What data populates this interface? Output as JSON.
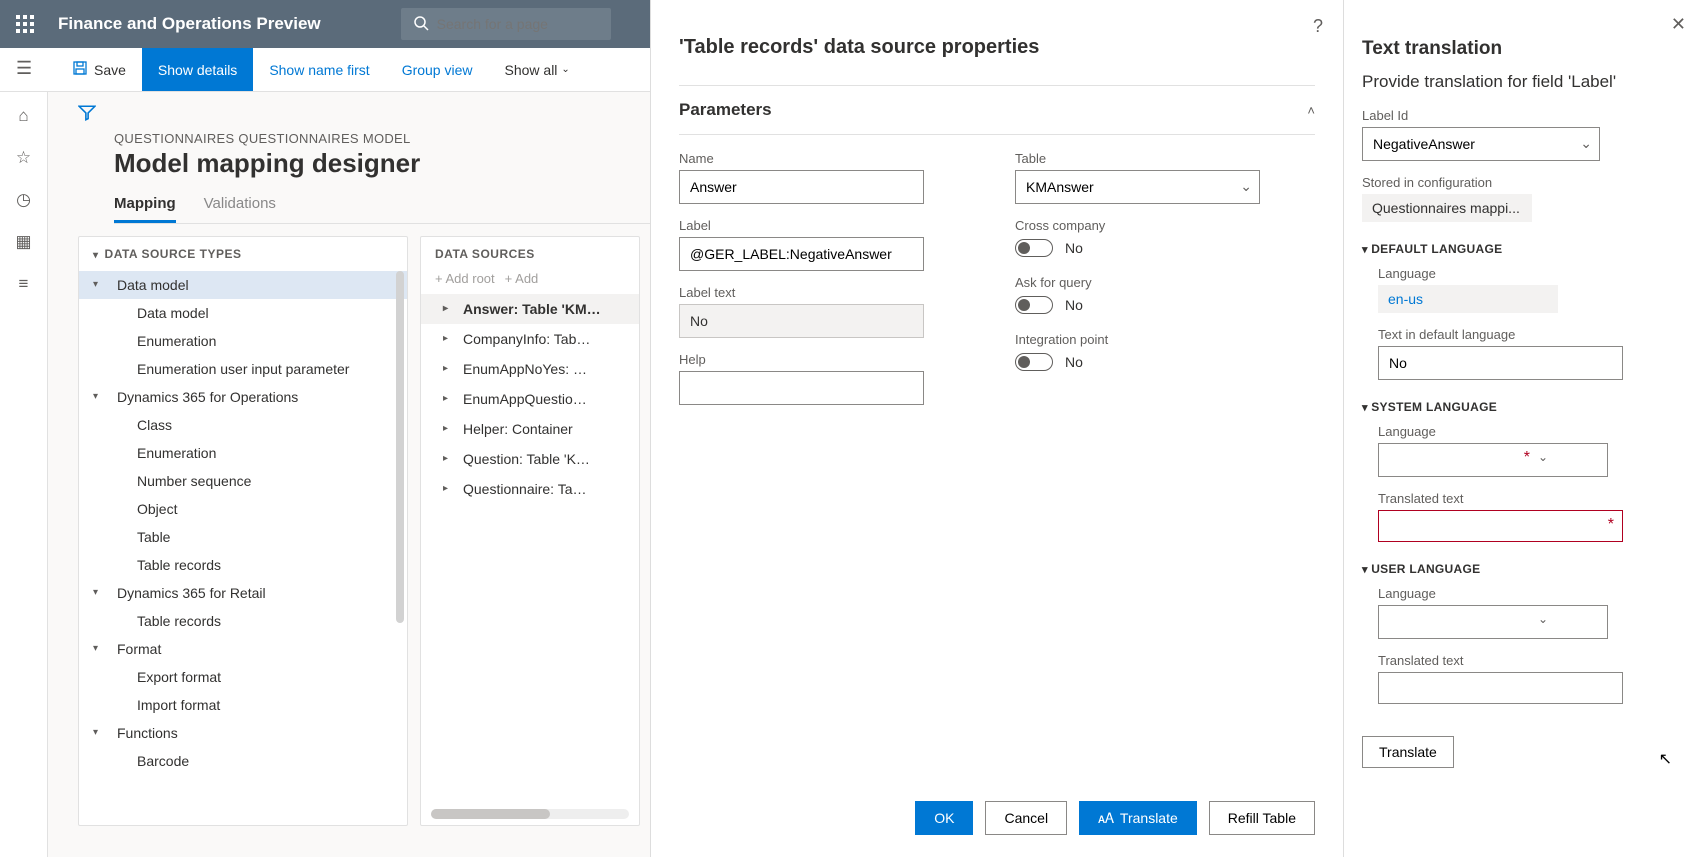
{
  "header": {
    "title": "Finance and Operations Preview",
    "search_placeholder": "Search for a page"
  },
  "actions": {
    "save": "Save",
    "show_details": "Show details",
    "show_name_first": "Show name first",
    "group_view": "Group view",
    "show_all": "Show all"
  },
  "page": {
    "breadcrumb": "QUESTIONNAIRES QUESTIONNAIRES MODEL",
    "title": "Model mapping designer",
    "tabs": [
      "Mapping",
      "Validations"
    ],
    "active_tab": 0
  },
  "ds_types": {
    "header": "DATA SOURCE TYPES",
    "items": [
      {
        "label": "Data model",
        "level": 0,
        "expanded": true,
        "selected": true
      },
      {
        "label": "Data model",
        "level": 1
      },
      {
        "label": "Enumeration",
        "level": 1
      },
      {
        "label": "Enumeration user input parameter",
        "level": 1
      },
      {
        "label": "Dynamics 365 for Operations",
        "level": 0,
        "expanded": true
      },
      {
        "label": "Class",
        "level": 1
      },
      {
        "label": "Enumeration",
        "level": 1
      },
      {
        "label": "Number sequence",
        "level": 1
      },
      {
        "label": "Object",
        "level": 1
      },
      {
        "label": "Table",
        "level": 1
      },
      {
        "label": "Table records",
        "level": 1
      },
      {
        "label": "Dynamics 365 for Retail",
        "level": 0,
        "expanded": true
      },
      {
        "label": "Table records",
        "level": 1
      },
      {
        "label": "Format",
        "level": 0,
        "expanded": true
      },
      {
        "label": "Export format",
        "level": 1
      },
      {
        "label": "Import format",
        "level": 1
      },
      {
        "label": "Functions",
        "level": 0,
        "expanded": true
      },
      {
        "label": "Barcode",
        "level": 1
      }
    ]
  },
  "ds_sources": {
    "header": "DATA SOURCES",
    "add_root": "Add root",
    "add": "Add",
    "items": [
      {
        "label": "Answer: Table 'KM…",
        "selected": true
      },
      {
        "label": "CompanyInfo: Tab…"
      },
      {
        "label": "EnumAppNoYes: …"
      },
      {
        "label": "EnumAppQuestio…"
      },
      {
        "label": "Helper: Container"
      },
      {
        "label": "Question: Table 'K…"
      },
      {
        "label": "Questionnaire: Ta…"
      }
    ]
  },
  "modal": {
    "title": "'Table records' data source properties",
    "parameters": "Parameters",
    "name_label": "Name",
    "name_value": "Answer",
    "label_label": "Label",
    "label_value": "@GER_LABEL:NegativeAnswer",
    "label_text_label": "Label text",
    "label_text_value": "No",
    "help_label": "Help",
    "help_value": "",
    "table_label": "Table",
    "table_value": "KMAnswer",
    "cross_company_label": "Cross company",
    "cross_company_value": "No",
    "ask_query_label": "Ask for query",
    "ask_query_value": "No",
    "integration_label": "Integration point",
    "integration_value": "No",
    "buttons": {
      "ok": "OK",
      "cancel": "Cancel",
      "translate": "Translate",
      "refill": "Refill Table"
    }
  },
  "rpanel": {
    "title": "Text translation",
    "subtitle": "Provide translation for field 'Label'",
    "label_id_label": "Label Id",
    "label_id_value": "NegativeAnswer",
    "stored_label": "Stored in configuration",
    "stored_value": "Questionnaires mappi...",
    "default_section": "DEFAULT LANGUAGE",
    "language_label": "Language",
    "default_lang_value": "en-us",
    "default_text_label": "Text in default language",
    "default_text_value": "No",
    "system_section": "SYSTEM LANGUAGE",
    "system_lang_value": "",
    "translated_text_label": "Translated text",
    "system_translated_value": "",
    "user_section": "USER LANGUAGE",
    "user_lang_value": "",
    "user_translated_value": "",
    "translate_btn": "Translate"
  }
}
